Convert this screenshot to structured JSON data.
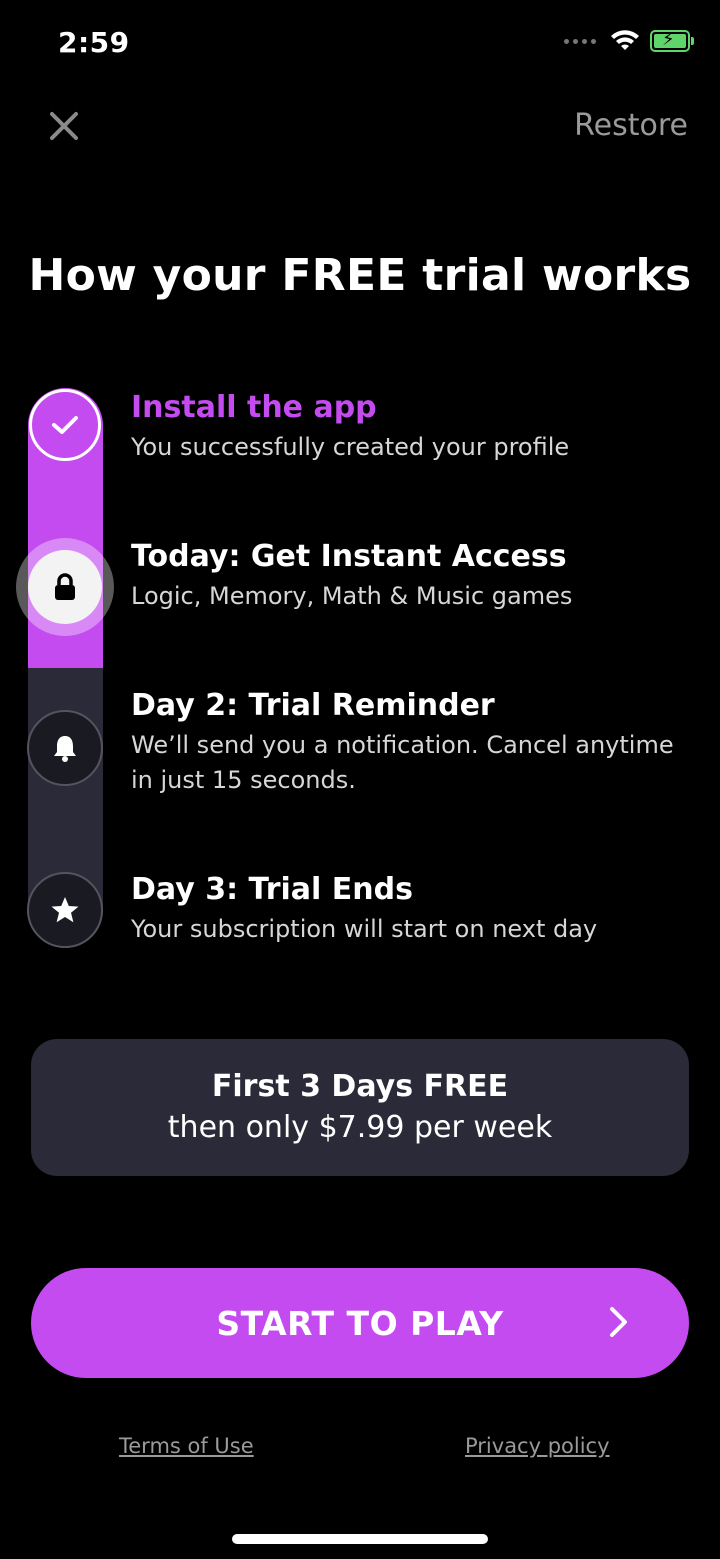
{
  "status_bar": {
    "time": "2:59",
    "signal_icon": "signal-dots-icon",
    "wifi_icon": "wifi-icon",
    "battery_icon": "battery-charging-icon",
    "battery_color": "#5fd46a"
  },
  "header": {
    "close_icon": "close-icon",
    "restore_label": "Restore"
  },
  "title": "How your FREE trial works",
  "steps": [
    {
      "title": "Install the app",
      "desc": "You successfully created your profile",
      "icon": "checkmark-icon",
      "state": "done"
    },
    {
      "title": "Today: Get Instant Access",
      "desc": "Logic, Memory, Math & Music games",
      "icon": "lock-icon",
      "state": "current"
    },
    {
      "title": "Day 2: Trial Reminder",
      "desc": "We’ll send you a notification. Cancel anytime in just 15 seconds.",
      "icon": "bell-icon",
      "state": "upcoming"
    },
    {
      "title": "Day 3: Trial Ends",
      "desc": "Your subscription will start on next day",
      "icon": "star-icon",
      "state": "upcoming"
    }
  ],
  "pricing": {
    "line1": "First 3 Days FREE",
    "line2": "then only $7.99 per week"
  },
  "cta": {
    "label": "START TO PLAY",
    "icon": "chevron-right-icon"
  },
  "footer": {
    "terms_label": "Terms of Use",
    "privacy_label": "Privacy policy"
  },
  "colors": {
    "accent": "#c44bf0",
    "card_bg": "#2b2a38",
    "background": "#000000"
  }
}
